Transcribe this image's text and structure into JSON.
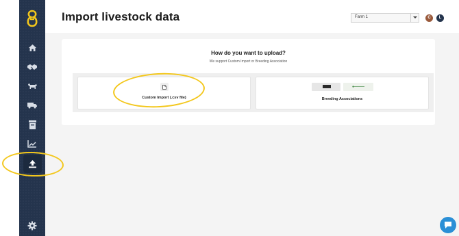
{
  "page": {
    "title": "Import livestock data"
  },
  "farm_selector": {
    "value": "Farm 1"
  },
  "user_avatars": [
    "C",
    "L"
  ],
  "upload_card": {
    "heading": "How do you want to upload?",
    "subheading": "We support Custom Import or Breeding Association",
    "options": [
      {
        "label": "Custom Import (.csv file)",
        "icon": "file-icon"
      },
      {
        "label": "Breeding Associations",
        "logos": [
          "association-logo-dark",
          "association-logo-green"
        ]
      }
    ]
  },
  "sidebar": {
    "items": [
      {
        "icon": "home-icon"
      },
      {
        "icon": "handshake-icon"
      },
      {
        "icon": "cow-icon"
      },
      {
        "icon": "truck-icon"
      },
      {
        "icon": "archive-icon"
      },
      {
        "icon": "chart-icon"
      },
      {
        "icon": "upload-icon",
        "active": true
      },
      {
        "icon": "gear-icon"
      }
    ]
  },
  "colors": {
    "sidebar": "#24344d",
    "highlight": "#f3c71c",
    "logo": "#f3c71c",
    "chat": "#2b8fd6"
  }
}
